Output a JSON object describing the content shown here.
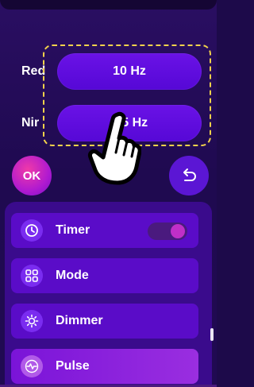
{
  "frequency": {
    "red": {
      "label": "Red",
      "value": "10 Hz"
    },
    "nir": {
      "label": "Nir",
      "value": "2.5 Hz"
    }
  },
  "actions": {
    "ok_label": "OK"
  },
  "menu": {
    "items": [
      {
        "label": "Timer",
        "icon": "clock-icon",
        "toggle_on": true
      },
      {
        "label": "Mode",
        "icon": "grid-icon"
      },
      {
        "label": "Dimmer",
        "icon": "brightness-icon"
      },
      {
        "label": "Pulse",
        "icon": "pulse-icon",
        "active": true
      }
    ]
  },
  "colors": {
    "accent": "#5a0cc8",
    "highlight_border": "#f2d24b",
    "ok_button": "#c21fc0",
    "toggle_knob": "#c02fc8"
  }
}
